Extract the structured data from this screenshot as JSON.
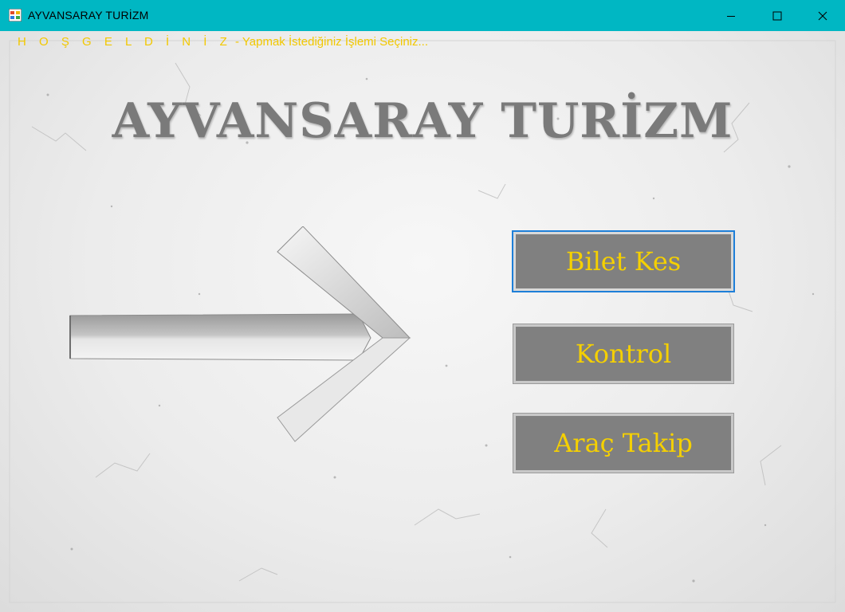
{
  "window": {
    "title": "AYVANSARAY TURİZM"
  },
  "welcome": {
    "greeting": "H O Ş G E L D İ N İ Z",
    "separator": " - ",
    "instruction": "Yapmak İstediğiniz İşlemi Seçiniz..."
  },
  "main": {
    "title": "AYVANSARAY TURİZM"
  },
  "menu": {
    "bilet_kes": "Bilet Kes",
    "kontrol": "Kontrol",
    "arac_takip": "Araç Takip"
  },
  "colors": {
    "titlebar": "#00b7c3",
    "accent_text": "#f2c800",
    "button_bg": "#808080",
    "focus_border": "#1e7fd8"
  }
}
